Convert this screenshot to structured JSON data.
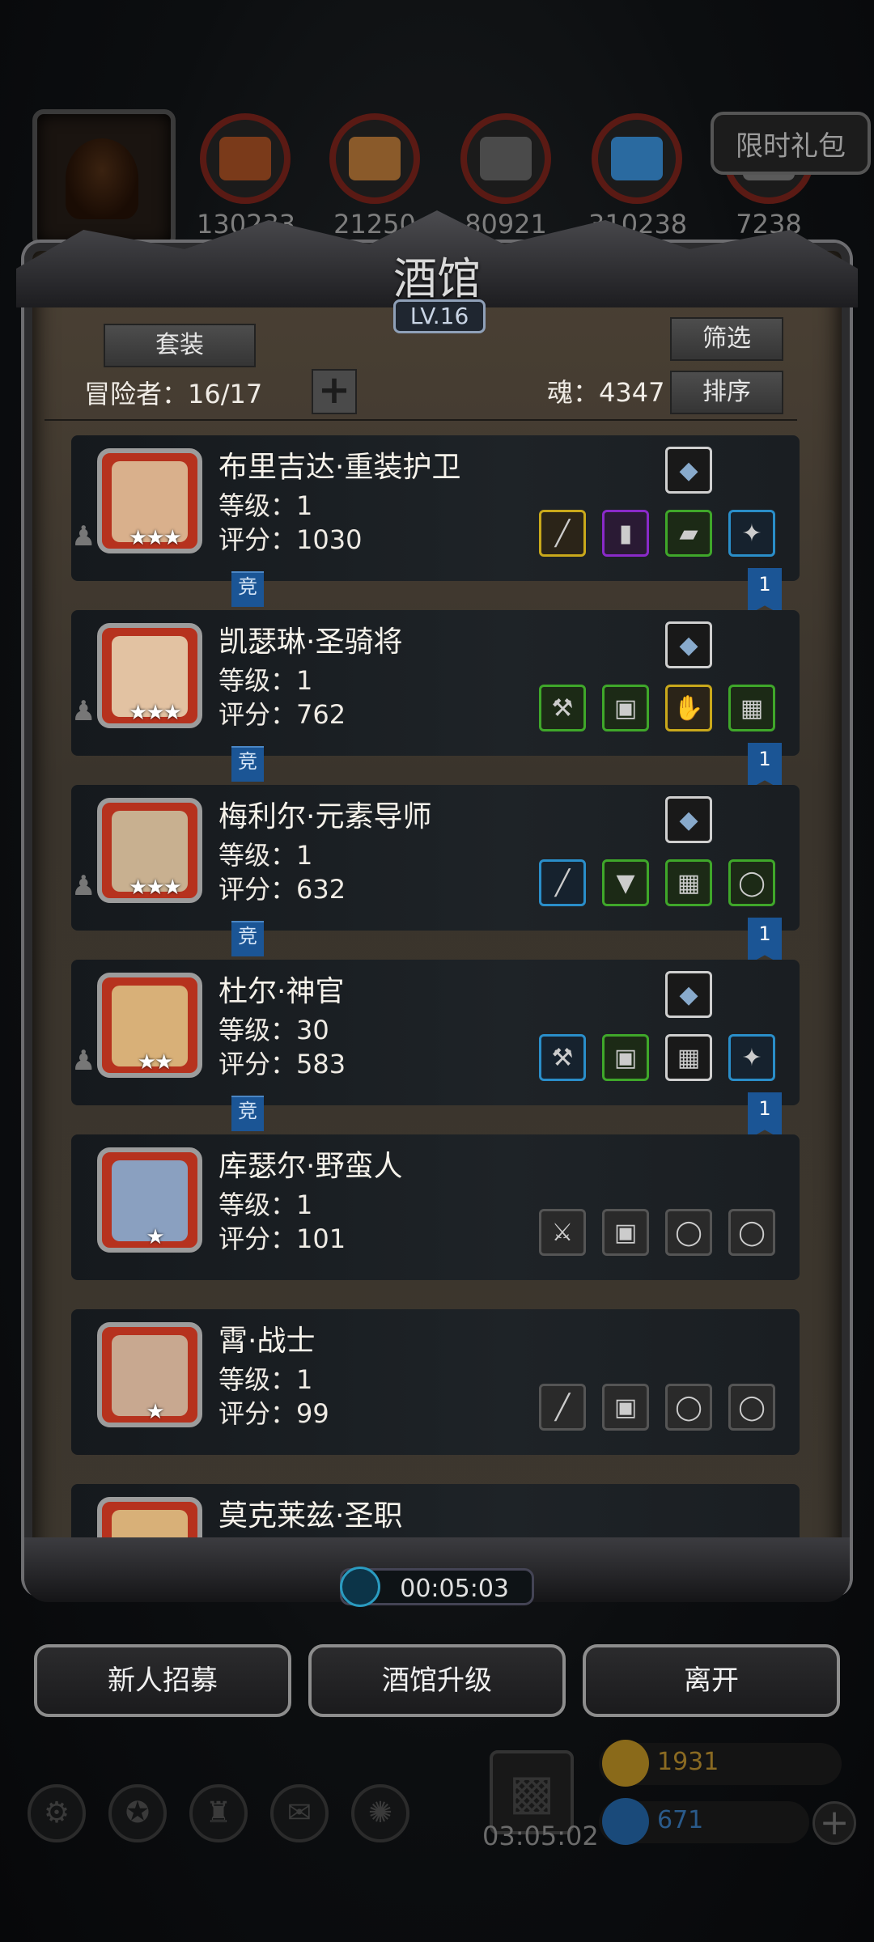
{
  "top": {
    "resources": [
      {
        "name": "food",
        "icon": "meat-icon",
        "value": "130233",
        "color": "#7a3a1a"
      },
      {
        "name": "wood",
        "icon": "wood-plank-icon",
        "value": "21250",
        "color": "#8a5a2a"
      },
      {
        "name": "stone",
        "icon": "stone-block-icon",
        "value": "80921",
        "color": "#4a4a4a"
      },
      {
        "name": "crystal",
        "icon": "crystal-icon",
        "value": "310238",
        "color": "#2a6aa0"
      },
      {
        "name": "iron",
        "icon": "iron-icon",
        "value": "7238",
        "color": "#5a5a5a"
      }
    ],
    "gift_label": "限时礼包"
  },
  "panel": {
    "title": "酒馆",
    "level": "LV.16",
    "set_label": "套装",
    "filter_label": "筛选",
    "sort_label": "排序",
    "adventurers": "冒险者：16/17",
    "soul": "魂：4347"
  },
  "heroes": [
    {
      "name": "布里吉达·重装护卫",
      "level": "等级：1",
      "score": "评分：1030",
      "stars": "★★★",
      "face": "#d9b08c",
      "gem": "gem-icon",
      "equip": [
        {
          "icon": "spear-icon",
          "c": "yellow",
          "g": "╱"
        },
        {
          "icon": "bucket-icon",
          "c": "purple",
          "g": "▮"
        },
        {
          "icon": "wooden-shield-icon",
          "c": "green",
          "g": "▰"
        },
        {
          "icon": "necklace-icon",
          "c": "blue",
          "g": "✦"
        }
      ],
      "badge": "竞",
      "rank": "1"
    },
    {
      "name": "凯瑟琳·圣骑将",
      "level": "等级：1",
      "score": "评分：762",
      "stars": "★★★",
      "face": "#e2c2a2",
      "gem": "claw-icon",
      "equip": [
        {
          "icon": "axe-icon",
          "c": "green",
          "g": "⚒"
        },
        {
          "icon": "armor-icon",
          "c": "green",
          "g": "▣"
        },
        {
          "icon": "gauntlet-icon",
          "c": "yellow",
          "g": "✋"
        },
        {
          "icon": "chest-armor-icon",
          "c": "green",
          "g": "▦"
        }
      ],
      "badge": "竞",
      "rank": "1"
    },
    {
      "name": "梅利尔·元素导师",
      "level": "等级：1",
      "score": "评分：632",
      "stars": "★★★",
      "face": "#c8b090",
      "gem": "crystal-shard-icon",
      "equip": [
        {
          "icon": "staff-icon",
          "c": "blue",
          "g": "╱"
        },
        {
          "icon": "robe-icon",
          "c": "green",
          "g": "▼"
        },
        {
          "icon": "chest-armor-icon",
          "c": "green",
          "g": "▦"
        },
        {
          "icon": "ring-icon",
          "c": "green",
          "g": "◯"
        }
      ],
      "badge": "竞",
      "rank": "1"
    },
    {
      "name": "杜尔·神官",
      "level": "等级：30",
      "score": "评分：583",
      "stars": "★★",
      "face": "#d8b078",
      "gem": "bow-icon",
      "equip": [
        {
          "icon": "hammer-icon",
          "c": "blue",
          "g": "⚒"
        },
        {
          "icon": "armor-icon",
          "c": "green",
          "g": "▣"
        },
        {
          "icon": "chest-armor-icon",
          "c": "white",
          "g": "▦"
        },
        {
          "icon": "necklace-icon",
          "c": "blue",
          "g": "✦"
        }
      ],
      "badge": "竞",
      "rank": "1"
    },
    {
      "name": "库瑟尔·野蛮人",
      "level": "等级：1",
      "score": "评分：101",
      "stars": "★",
      "face": "#8aa0c0",
      "gem": "",
      "equip": [
        {
          "icon": "axe-slot-icon",
          "c": "empty",
          "g": "⚔"
        },
        {
          "icon": "armor-slot-icon",
          "c": "empty",
          "g": "▣"
        },
        {
          "icon": "ring-slot-icon",
          "c": "empty",
          "g": "◯"
        },
        {
          "icon": "ring-slot-icon",
          "c": "empty",
          "g": "◯"
        }
      ],
      "badge": "",
      "rank": ""
    },
    {
      "name": "霄·战士",
      "level": "等级：1",
      "score": "评分：99",
      "stars": "★",
      "face": "#c8a890",
      "gem": "",
      "equip": [
        {
          "icon": "sword-slot-icon",
          "c": "empty",
          "g": "╱"
        },
        {
          "icon": "armor-slot-icon",
          "c": "empty",
          "g": "▣"
        },
        {
          "icon": "ring-slot-icon",
          "c": "empty",
          "g": "◯"
        },
        {
          "icon": "ring-slot-icon",
          "c": "empty",
          "g": "◯"
        }
      ],
      "badge": "",
      "rank": ""
    },
    {
      "name": "莫克莱兹·圣职",
      "level": "",
      "score": "",
      "stars": "",
      "face": "#d8b078",
      "gem": "",
      "equip": [],
      "badge": "",
      "rank": ""
    }
  ],
  "timer": "00:05:03",
  "buttons": {
    "recruit": "新人招募",
    "upgrade": "酒馆升级",
    "leave": "离开"
  },
  "footer": {
    "gift_timer": "03:05:02",
    "gold": "1931",
    "gems": "671"
  }
}
